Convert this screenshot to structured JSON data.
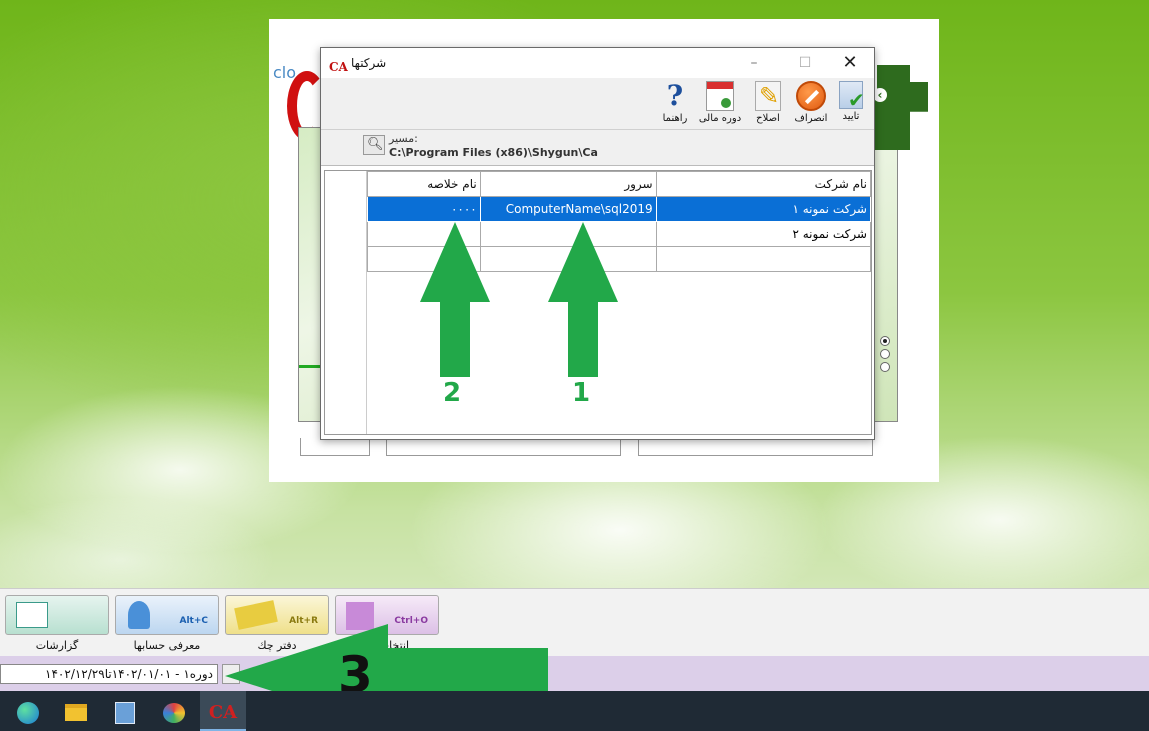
{
  "background_window": {
    "logo_text": "clo"
  },
  "dialog": {
    "title": "شرکتها",
    "logo": "CA",
    "toolbar": [
      {
        "label": "تایید",
        "icon": "confirm-icon"
      },
      {
        "label": "انصراف",
        "icon": "cancel-icon"
      },
      {
        "label": "اصلاح",
        "icon": "edit-icon"
      },
      {
        "label": "دوره مالی",
        "icon": "calendar-icon"
      },
      {
        "label": "راهنما",
        "icon": "help-icon"
      }
    ],
    "path_label": "مسیر:",
    "path_value": "C:\\Program Files (x86)\\Shygun\\Ca",
    "table": {
      "headers": {
        "short_name": "نام خلاصه",
        "server": "سرور",
        "company": "نام شرکت"
      },
      "rows": [
        {
          "short_name": "۰۰۰۰",
          "server": "ComputerName\\sql2019",
          "company": "شرکت نمونه ۱",
          "selected": true
        },
        {
          "short_name": "",
          "server": "",
          "company": "شرکت نمونه ۲",
          "selected": false
        }
      ]
    }
  },
  "annotations": {
    "one": "1",
    "two": "2",
    "three": "3"
  },
  "shortcuts": [
    {
      "label": "گزارشات",
      "key": ""
    },
    {
      "label": "معرفی حسابها",
      "key": "Alt+C"
    },
    {
      "label": "دفتر چك",
      "key": "Alt+R"
    },
    {
      "label": "انتخاب ب",
      "key": "Ctrl+O"
    }
  ],
  "status": {
    "period": "دوره۱ - ۱۴۰۲/۰۱/۰۱تا۱۴۰۲/۱۲/۲۹"
  },
  "colors": {
    "selection": "#0a6fd6",
    "annotation_green": "#22a849",
    "status_bar": "#dccfe9"
  }
}
